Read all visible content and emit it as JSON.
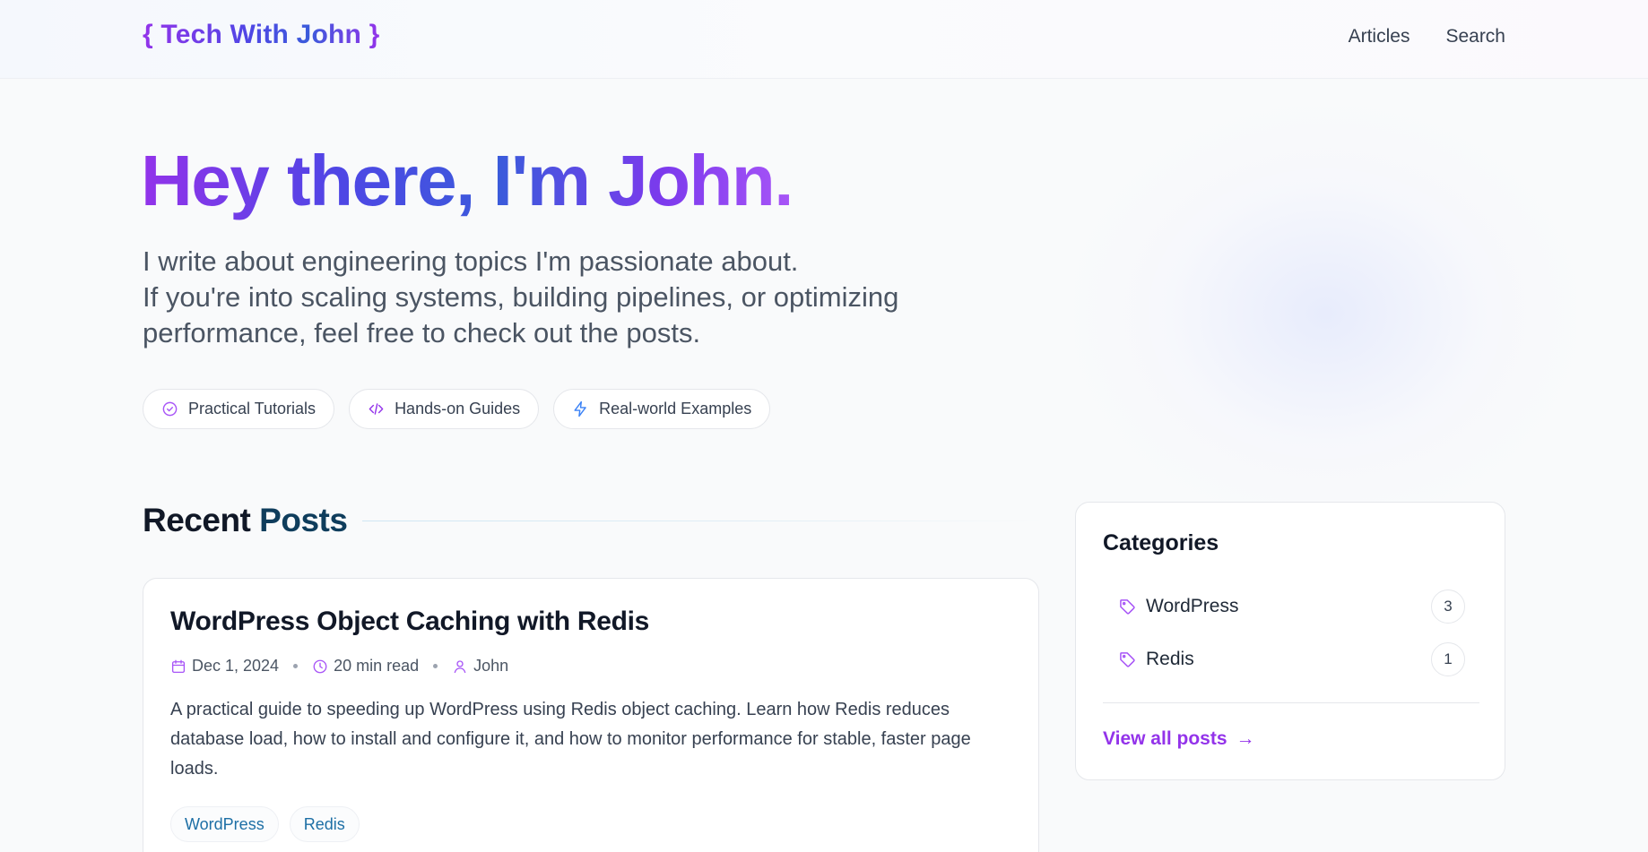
{
  "header": {
    "logo": "{ Tech With John }",
    "nav": [
      {
        "label": "Articles"
      },
      {
        "label": "Search"
      }
    ]
  },
  "hero": {
    "title": "Hey there, I'm John.",
    "subtitle_lines": [
      "I write about engineering topics I'm passionate about.",
      "If you're into scaling systems, building pipelines, or optimizing",
      "performance, feel free to check out the posts."
    ],
    "pills": [
      {
        "label": "Practical Tutorials",
        "icon": "check-circle-icon"
      },
      {
        "label": "Hands-on Guides",
        "icon": "code-icon"
      },
      {
        "label": "Real-world Examples",
        "icon": "lightning-icon"
      }
    ]
  },
  "recent_posts": {
    "title_part1": "Recent",
    "title_part2": "Posts",
    "posts": [
      {
        "title": "WordPress Object Caching with Redis",
        "date": "Dec 1, 2024",
        "read_time": "20 min read",
        "author": "John",
        "excerpt": "A practical guide to speeding up WordPress using Redis object caching. Learn how Redis reduces database load, how to install and configure it, and how to monitor performance for stable, faster page loads.",
        "tags": [
          "WordPress",
          "Redis"
        ]
      }
    ]
  },
  "categories": {
    "title": "Categories",
    "items": [
      {
        "name": "WordPress",
        "count": "3"
      },
      {
        "name": "Redis",
        "count": "1"
      }
    ],
    "view_all": "View all posts",
    "arrow": "→"
  },
  "colors": {
    "accent_purple": "#9333ea",
    "accent_blue": "#3b5bdb",
    "tag_blue": "#1d6fa5",
    "heading_navy": "#0f3d5c"
  }
}
